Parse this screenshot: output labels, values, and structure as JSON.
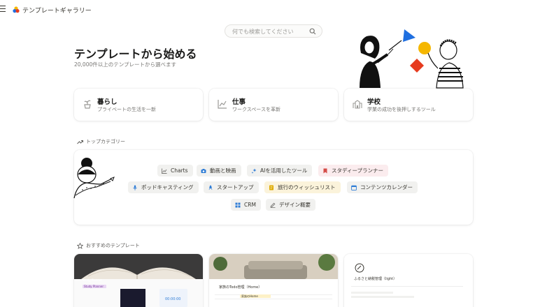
{
  "app": {
    "title": "テンプレートギャラリー"
  },
  "search": {
    "placeholder": "何でも検索してください"
  },
  "hero": {
    "title": "テンプレートから始める",
    "subtitle": "20,000件以上のテンプレートから選べます"
  },
  "categories": [
    {
      "title": "暮らし",
      "subtitle": "プライベートの生活を一新",
      "icon": "plant-icon"
    },
    {
      "title": "仕事",
      "subtitle": "ワークスペースを革新",
      "icon": "chart-icon"
    },
    {
      "title": "学校",
      "subtitle": "学業の成功を後押しするツール",
      "icon": "school-icon"
    }
  ],
  "top_categories": {
    "label": "トップカテゴリー",
    "chips": [
      {
        "label": "Charts",
        "icon": "line-chart-icon",
        "bg": "#f1f1ef",
        "color": "#37352f",
        "icon_color": "#787774"
      },
      {
        "label": "動画と映画",
        "icon": "camera-icon",
        "bg": "#f1f1ef",
        "color": "#37352f",
        "icon_color": "#2e7cd6"
      },
      {
        "label": "AIを活用したツール",
        "icon": "sparkle-icon",
        "bg": "#f1f1ef",
        "color": "#37352f",
        "icon_color": "#2e7cd6"
      },
      {
        "label": "スタディープランナー",
        "icon": "bookmark-icon",
        "bg": "#fbecee",
        "color": "#37352f",
        "icon_color": "#d44c47"
      },
      {
        "label": "ポッドキャスティング",
        "icon": "microphone-icon",
        "bg": "#f1f1ef",
        "color": "#37352f",
        "icon_color": "#2e7cd6"
      },
      {
        "label": "スタートアップ",
        "icon": "rocket-icon",
        "bg": "#f1f1ef",
        "color": "#37352f",
        "icon_color": "#2e7cd6"
      },
      {
        "label": "旅行のウィッシュリスト",
        "icon": "note-icon",
        "bg": "#fbf3db",
        "color": "#37352f",
        "icon_color": "#dfab01"
      },
      {
        "label": "コンテンツカレンダー",
        "icon": "calendar-icon",
        "bg": "#f1f1ef",
        "color": "#37352f",
        "icon_color": "#2e7cd6"
      },
      {
        "label": "CRM",
        "icon": "grid-icon",
        "bg": "#f1f1ef",
        "color": "#37352f",
        "icon_color": "#2e7cd6"
      },
      {
        "label": "デザイン概要",
        "icon": "pencil-icon",
        "bg": "#f1f1ef",
        "color": "#37352f",
        "icon_color": "#787774"
      }
    ]
  },
  "recommended": {
    "label": "おすすめのテンプレート",
    "cards": [
      {
        "preview_title": "Study Planner",
        "preview_text": "00:00:00"
      },
      {
        "preview_title": "家族のTodo管理（Home）",
        "preview_text": "家族のHome"
      },
      {
        "preview_title": "ふるさと納税管理（light）",
        "preview_text": ""
      }
    ]
  },
  "colors": {
    "accent_blue": "#2e7cd6",
    "art_blue": "#1f6fe0",
    "art_yellow": "#f5b700",
    "art_red": "#e63b1f"
  }
}
